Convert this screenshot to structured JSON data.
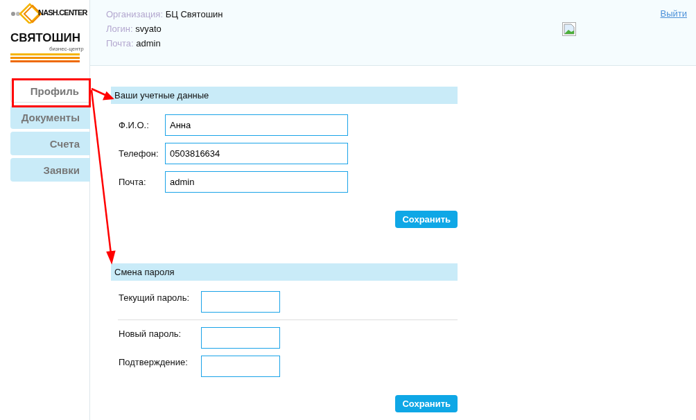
{
  "logo": {
    "brand": "NASH.CENTER",
    "name": "СВЯТОШИН",
    "tagline": "бизнес-центр"
  },
  "header": {
    "info": [
      {
        "label": "Организация:",
        "value": "БЦ Святошин"
      },
      {
        "label": "Логин:",
        "value": "svyato"
      },
      {
        "label": "Почта:",
        "value": "admin"
      }
    ],
    "logout": "Выйти"
  },
  "nav": [
    {
      "label": "Профиль",
      "selected": true
    },
    {
      "label": "Документы",
      "selected": false
    },
    {
      "label": "Счета",
      "selected": false
    },
    {
      "label": "Заявки",
      "selected": false
    }
  ],
  "account": {
    "title": "Ваши учетные данные",
    "fields": [
      {
        "label": "Ф.И.О.:",
        "value": "Анна"
      },
      {
        "label": "Телефон:",
        "value": "0503816634"
      },
      {
        "label": "Почта:",
        "value": "admin"
      }
    ],
    "save": "Сохранить"
  },
  "password": {
    "title": "Смена пароля",
    "current": {
      "label": "Текущий пароль:"
    },
    "fields": [
      {
        "label": "Новый пароль:"
      },
      {
        "label": "Подтверждение:"
      }
    ],
    "save": "Сохранить"
  }
}
